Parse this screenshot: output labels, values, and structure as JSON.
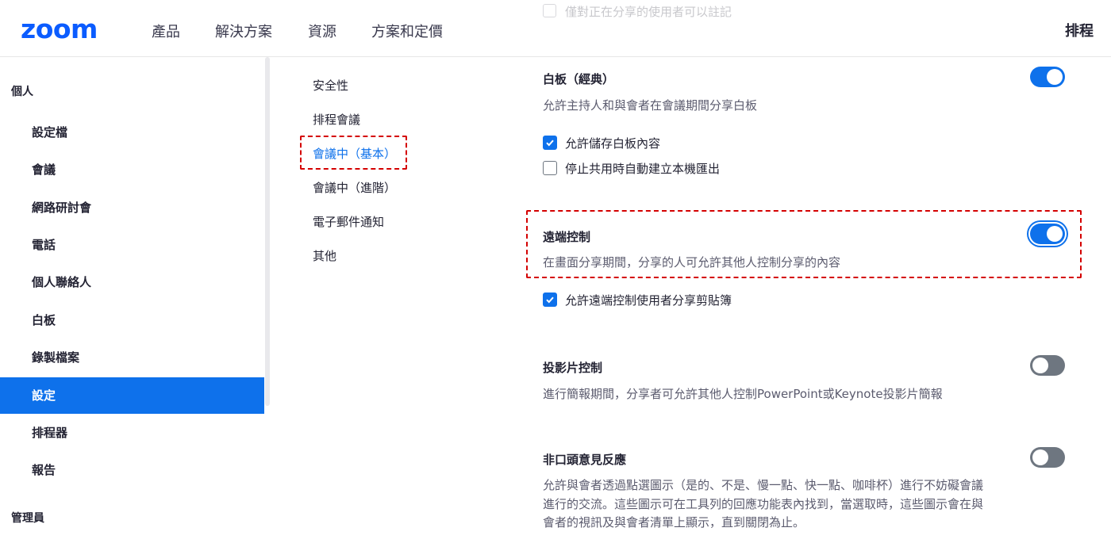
{
  "header": {
    "logo": "zoom",
    "nav": [
      "產品",
      "解決方案",
      "資源",
      "方案和定價"
    ],
    "schedule": "排程",
    "ghost_text": "僅對正在分享的使用者可以註記"
  },
  "sidebar": {
    "section_personal": "個人",
    "items": [
      "設定檔",
      "會議",
      "網路研討會",
      "電話",
      "個人聯絡人",
      "白板",
      "錄製檔案",
      "設定",
      "排程器",
      "報告"
    ],
    "active_index": 7,
    "section_admin": "管理員"
  },
  "subnav": {
    "items": [
      "安全性",
      "排程會議",
      "會議中（基本）",
      "會議中（進階）",
      "電子郵件通知",
      "其他"
    ],
    "active_index": 2
  },
  "settings": {
    "whiteboard": {
      "title": "白板（經典）",
      "desc": "允許主持人和與會者在會議期間分享白板",
      "enabled": true,
      "options": [
        {
          "label": "允許儲存白板內容",
          "checked": true
        },
        {
          "label": "停止共用時自動建立本機匯出",
          "checked": false
        }
      ]
    },
    "remote_control": {
      "title": "遠端控制",
      "desc": "在畫面分享期間，分享的人可允許其他人控制分享的內容",
      "enabled": true,
      "options": [
        {
          "label": "允許遠端控制使用者分享剪貼簿",
          "checked": true
        }
      ]
    },
    "slide_control": {
      "title": "投影片控制",
      "desc": "進行簡報期間，分享者可允許其他人控制PowerPoint或Keynote投影片簡報",
      "enabled": false
    },
    "nonverbal_feedback": {
      "title": "非口頭意見反應",
      "desc_lines": [
        "允許與會者透過點選圖示（是的、不是、慢一點、快一點、咖啡杯）進行不妨礙會議",
        "進行的交流。這些圖示可在工具列的回應功能表內找到，當選取時，這些圖示會在與",
        "會者的視訊及與會者清單上顯示，直到關閉為止。"
      ],
      "enabled": false
    }
  },
  "colors": {
    "brand": "#0b5cff",
    "accent": "#0e71eb",
    "highlight_dash": "#d40000"
  }
}
